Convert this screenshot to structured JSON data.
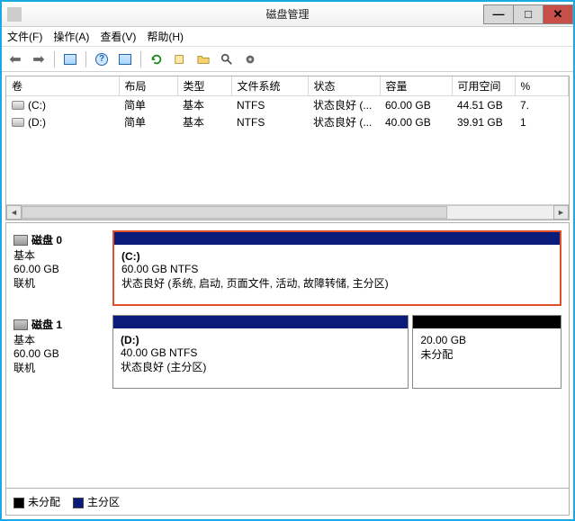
{
  "window": {
    "title": "磁盘管理"
  },
  "menu": {
    "file": "文件(F)",
    "action": "操作(A)",
    "view": "查看(V)",
    "help": "帮助(H)"
  },
  "columns": {
    "vol": "卷",
    "layout": "布局",
    "type": "类型",
    "fs": "文件系统",
    "status": "状态",
    "capacity": "容量",
    "free": "可用空间",
    "pct": "%"
  },
  "rows": [
    {
      "name": "(C:)",
      "layout": "简单",
      "type": "基本",
      "fs": "NTFS",
      "status": "状态良好 (...",
      "capacity": "60.00 GB",
      "free": "44.51 GB",
      "pct": "7."
    },
    {
      "name": "(D:)",
      "layout": "简单",
      "type": "基本",
      "fs": "NTFS",
      "status": "状态良好 (...",
      "capacity": "40.00 GB",
      "free": "39.91 GB",
      "pct": "1"
    }
  ],
  "disks": [
    {
      "title": "磁盘 0",
      "kind": "基本",
      "size": "60.00 GB",
      "state": "联机",
      "volumes": [
        {
          "name": "(C:)",
          "sizefs": "60.00 GB NTFS",
          "status": "状态良好 (系统, 启动, 页面文件, 活动, 故障转储, 主分区)",
          "class": "highlight"
        }
      ]
    },
    {
      "title": "磁盘 1",
      "kind": "基本",
      "size": "60.00 GB",
      "state": "联机",
      "volumes": [
        {
          "name": "(D:)",
          "sizefs": "40.00 GB NTFS",
          "status": "状态良好 (主分区)",
          "class": "d40"
        },
        {
          "name": "",
          "sizefs": "20.00 GB",
          "status": "未分配",
          "class": "unalloc d20"
        }
      ]
    }
  ],
  "legend": {
    "unalloc": "未分配",
    "primary": "主分区"
  }
}
